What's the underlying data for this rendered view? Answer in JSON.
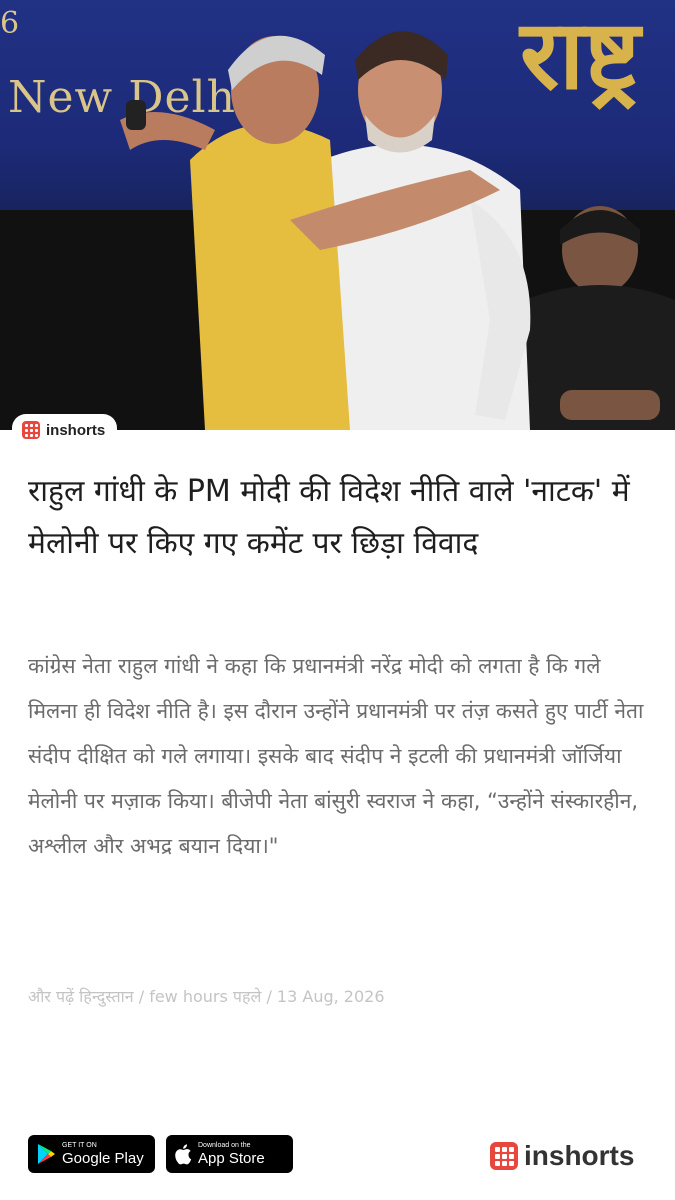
{
  "hero": {
    "backdrop_number": "6",
    "backdrop_city": "New Delh",
    "backdrop_big_text": "राष्ट्र",
    "description_icon_names": [
      "inshorts-logo-icon"
    ]
  },
  "badge": {
    "label": "inshorts"
  },
  "article": {
    "headline": "राहुल गांधी के PM मोदी की विदेश नीति वाले 'नाटक' में मेलोनी पर किए गए कमेंट पर छिड़ा विवाद",
    "body": "कांग्रेस नेता राहुल गांधी ने कहा कि प्रधानमंत्री नरेंद्र मोदी को लगता है कि गले मिलना ही विदेश नीति है। इस दौरान उन्होंने प्रधानमंत्री पर तंज़ कसते हुए पार्टी नेता संदीप दीक्षित को गले लगाया। इसके बाद संदीप ने इटली की प्रधानमंत्री जॉर्जिया मेलोनी पर मज़ाक किया। बीजेपी नेता बांसुरी स्वराज ने कहा, “उन्होंने संस्कारहीन, अश्लील और अभद्र बयान दिया।\"",
    "meta": {
      "read_more": "और पढ़ें हिन्दुस्तान",
      "separator": " / ",
      "time": "few hours पहले",
      "date": "13 Aug, 2026"
    }
  },
  "footer": {
    "google_play": {
      "small": "GET IT ON",
      "big": "Google Play"
    },
    "app_store": {
      "small": "Download on the",
      "big": "App Store"
    },
    "brand": "inshorts"
  },
  "colors": {
    "brand_red": "#e8473e",
    "headline": "#1e1e1e",
    "body": "#6b6b6b",
    "meta": "#c4c4c4"
  }
}
